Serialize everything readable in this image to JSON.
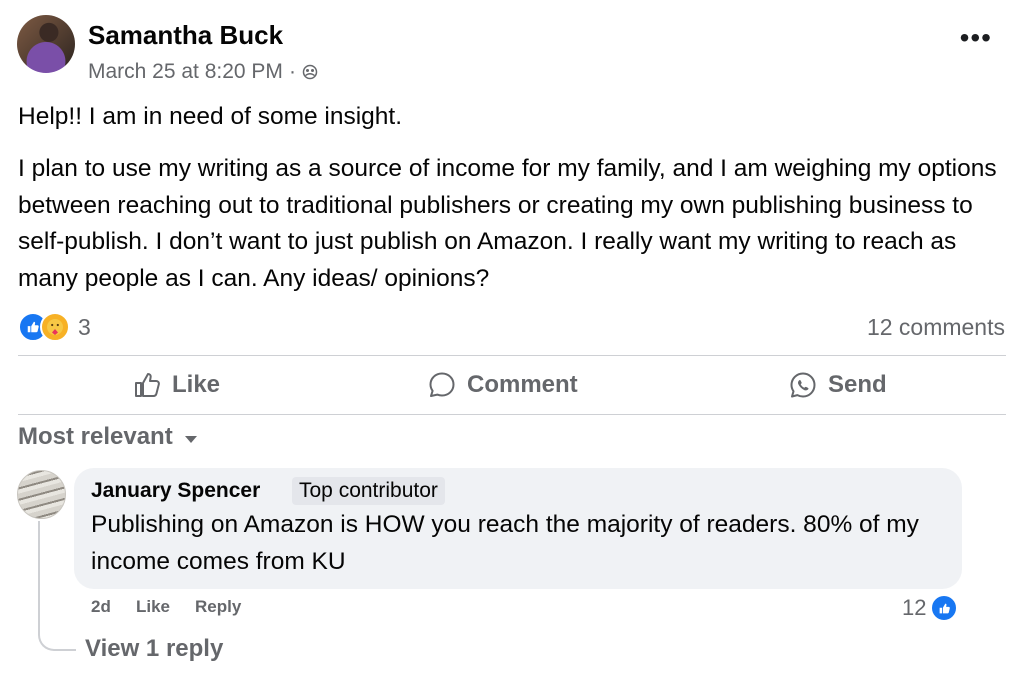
{
  "post": {
    "author": "Samantha Buck",
    "timestamp": "March 25 at 8:20 PM",
    "separator": "·",
    "audience_icon": "friends-group-icon",
    "more_label": "•••",
    "paragraph1": "Help!! I am in need of some insight.",
    "paragraph2": "I plan to use my writing as a source of income for my family, and I am weighing my options between reaching out to traditional publishers or creating my own publishing business to self-publish. I don’t want to just publish on Amazon. I really want my writing to reach as many people as I can. Any ideas/ opinions?",
    "reaction_count": "3",
    "comments_count": "12 comments",
    "reaction_icons": [
      "like-icon",
      "care-icon"
    ],
    "accent_color": "#1877f2"
  },
  "actions": {
    "like": "Like",
    "comment": "Comment",
    "send": "Send"
  },
  "comments_section": {
    "sort_label": "Most relevant",
    "comment": {
      "author": "January Spencer",
      "badge": "Top contributor",
      "text": "Publishing on Amazon is HOW you reach the majority of readers. 80% of my income comes from KU",
      "age": "2d",
      "like_label": "Like",
      "reply_label": "Reply",
      "reaction_count": "12"
    },
    "view_replies": "View 1 reply"
  }
}
